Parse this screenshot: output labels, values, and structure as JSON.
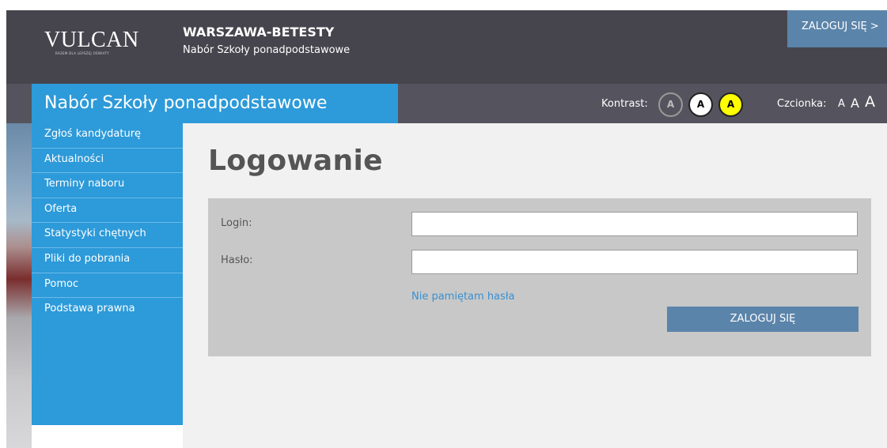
{
  "header": {
    "logo_text": "VULCAN",
    "logo_tagline": "RAZEM DLA LEPSZEJ OŚWIATY",
    "unit_name": "WARSZAWA-BETESTY",
    "unit_subtitle": "Nabór Szkoły ponadpodstawowe",
    "login_button": "ZALOGUJ SIĘ >"
  },
  "subheader": {
    "system_title": "Nabór Szkoły ponadpodstawowe",
    "contrast_label": "Kontrast:",
    "contrast_options": [
      "A",
      "A",
      "A"
    ],
    "font_label": "Czcionka:",
    "font_options": [
      "A",
      "A",
      "A"
    ]
  },
  "sidebar": {
    "items": [
      {
        "label": "Zgłoś kandydaturę"
      },
      {
        "label": "Aktualności"
      },
      {
        "label": "Terminy naboru"
      },
      {
        "label": "Oferta"
      },
      {
        "label": "Statystyki chętnych"
      },
      {
        "label": "Pliki do pobrania"
      },
      {
        "label": "Pomoc"
      },
      {
        "label": "Podstawa prawna"
      }
    ]
  },
  "main": {
    "title": "Logowanie",
    "login_label": "Login:",
    "login_value": "",
    "password_label": "Hasło:",
    "password_value": "",
    "forgot_password": "Nie pamiętam hasła",
    "submit_label": "ZALOGUJ SIĘ"
  },
  "colors": {
    "header_bg": "#46454d",
    "subheader_bg": "#55545e",
    "accent_blue": "#2d9ad9",
    "button_blue": "#5b84aa",
    "link_blue": "#3a8fd0"
  }
}
